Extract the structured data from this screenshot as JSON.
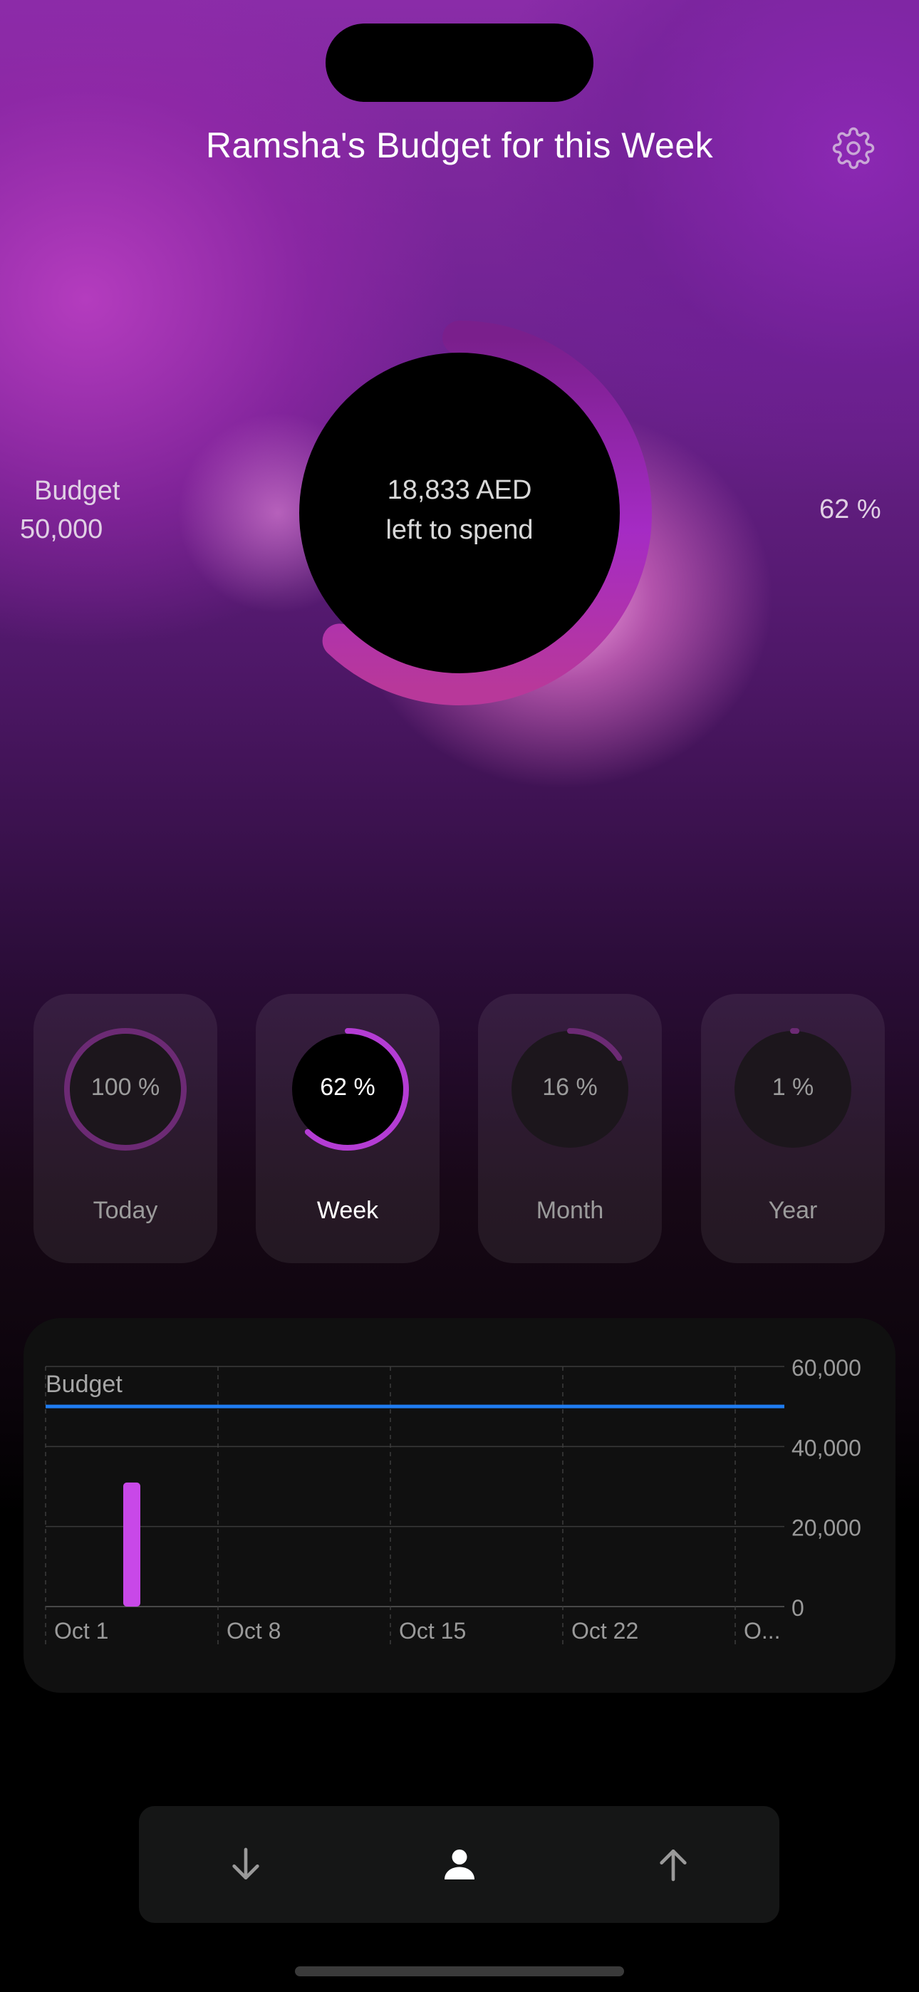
{
  "header": {
    "title": "Ramsha's Budget for this Week",
    "settings_icon": "gear-icon"
  },
  "summary": {
    "budget_label": "Budget",
    "budget_value": "50,000",
    "remaining_amount": "18,833 AED",
    "remaining_caption": "left to spend",
    "percent_label": "62 %",
    "percent_value": 0.62
  },
  "periods": [
    {
      "label": "Today",
      "percent_label": "100 %",
      "value": 1.0,
      "active": false
    },
    {
      "label": "Week",
      "percent_label": "62 %",
      "value": 0.62,
      "active": true
    },
    {
      "label": "Month",
      "percent_label": "16 %",
      "value": 0.16,
      "active": false
    },
    {
      "label": "Year",
      "percent_label": "1 %",
      "value": 0.01,
      "active": false
    }
  ],
  "chart_data": {
    "type": "bar",
    "legend_label": "Budget",
    "x_tick_labels": [
      "Oct 1",
      "Oct 8",
      "Oct 15",
      "Oct 22",
      "O..."
    ],
    "y_tick_labels": [
      "60,000",
      "40,000",
      "20,000",
      "0"
    ],
    "y_ticks": [
      60000,
      40000,
      20000,
      0
    ],
    "ylim": [
      0,
      60000
    ],
    "budget_line": 50000,
    "bars": [
      {
        "x": "Oct 4",
        "day_index": 3,
        "value": 31000
      }
    ],
    "x_domain_days": 30,
    "colors": {
      "budget_line": "#1f7cf0",
      "bar": "#c848e8"
    }
  },
  "tabbar": {
    "items": [
      {
        "icon": "arrow-down-icon"
      },
      {
        "icon": "person-icon"
      },
      {
        "icon": "arrow-up-icon"
      }
    ]
  }
}
